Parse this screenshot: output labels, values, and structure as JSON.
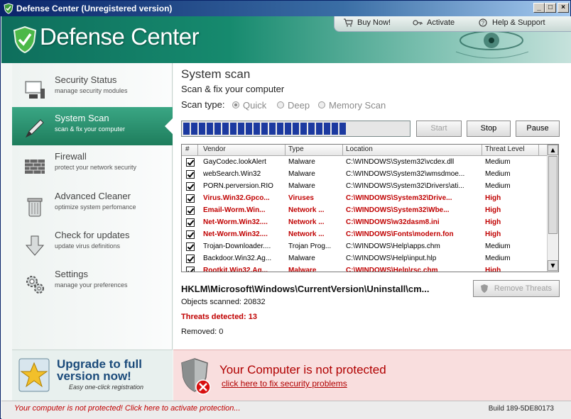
{
  "window": {
    "title": "Defense Center (Unregistered version)",
    "min": "_",
    "max": "□",
    "close": "×"
  },
  "header": {
    "app_title": "Defense Center",
    "nav": {
      "buy": "Buy Now!",
      "activate": "Activate",
      "help": "Help & Support"
    }
  },
  "sidebar": {
    "items": [
      {
        "label": "Security Status",
        "sub": "manage security modules",
        "icon": "monitor-icon"
      },
      {
        "label": "System Scan",
        "sub": "scan & fix your computer",
        "icon": "pen-scan-icon"
      },
      {
        "label": "Firewall",
        "sub": "protect your network security",
        "icon": "brick-wall-icon"
      },
      {
        "label": "Advanced Cleaner",
        "sub": "optimize system perfomance",
        "icon": "trash-can-icon"
      },
      {
        "label": "Check for updates",
        "sub": "update virus definitions",
        "icon": "down-arrow-icon"
      },
      {
        "label": "Settings",
        "sub": "manage your preferences",
        "icon": "gears-icon"
      }
    ],
    "active_index": 1
  },
  "upgrade": {
    "line1": "Upgrade to full",
    "line2": "version now!",
    "sub": "Easy one-click registration"
  },
  "main": {
    "title": "System scan",
    "subtitle": "Scan & fix your computer",
    "scan_type_label": "Scan type:",
    "scan_types": [
      "Quick",
      "Deep",
      "Memory Scan"
    ],
    "selected_scan_type": "Quick",
    "progress_fraction": 0.73,
    "buttons": {
      "start": "Start",
      "stop": "Stop",
      "pause": "Pause",
      "remove": "Remove Threats"
    },
    "table": {
      "headers": [
        "#",
        "Vendor",
        "Type",
        "Location",
        "Threat Level"
      ],
      "rows": [
        {
          "vendor": "GayCodec.lookAlert",
          "type": "Malware",
          "location": "C:\\WINDOWS\\System32\\vcdex.dll",
          "level": "Medium",
          "high": false
        },
        {
          "vendor": "webSearch.Win32",
          "type": "Malware",
          "location": "C:\\WINDOWS\\System32\\wmsdmoe...",
          "level": "Medium",
          "high": false
        },
        {
          "vendor": "PORN.perversion.RIO",
          "type": "Malware",
          "location": "C:\\WINDOWS\\System32\\Drivers\\ati...",
          "level": "Medium",
          "high": false
        },
        {
          "vendor": "Virus.Win32.Gpco...",
          "type": "Viruses",
          "location": "C:\\WINDOWS\\System32\\Drive...",
          "level": "High",
          "high": true
        },
        {
          "vendor": "Email-Worm.Win...",
          "type": "Network ...",
          "location": "C:\\WINDOWS\\System32\\Wbe...",
          "level": "High",
          "high": true
        },
        {
          "vendor": "Net-Worm.Win32....",
          "type": "Network ...",
          "location": "C:\\WINDOWS\\w32dasm8.ini",
          "level": "High",
          "high": true
        },
        {
          "vendor": "Net-Worm.Win32....",
          "type": "Network ...",
          "location": "C:\\WINDOWS\\Fonts\\modern.fon",
          "level": "High",
          "high": true
        },
        {
          "vendor": "Trojan-Downloader....",
          "type": "Trojan Prog...",
          "location": "C:\\WINDOWS\\Help\\apps.chm",
          "level": "Medium",
          "high": false
        },
        {
          "vendor": "Backdoor.Win32.Ag...",
          "type": "Malware",
          "location": "C:\\WINDOWS\\Help\\input.hlp",
          "level": "Medium",
          "high": false
        },
        {
          "vendor": "Rootkit.Win32.Ag...",
          "type": "Malware",
          "location": "C:\\WINDOWS\\Help\\rsc.chm",
          "level": "High",
          "high": true
        }
      ]
    },
    "current_path": "HKLM\\Microsoft\\Windows\\CurrentVersion\\Uninstall\\cm...",
    "objects_scanned": "Objects scanned: 20832",
    "threats_detected": "Threats detected: 13",
    "removed": "Removed: 0"
  },
  "banner": {
    "message": "Your Computer is not protected",
    "link": "click here to fix security problems"
  },
  "statusbar": {
    "warning": "Your computer is not protected! Click here to activate protection...",
    "build": "Build 189-5DE80173"
  }
}
